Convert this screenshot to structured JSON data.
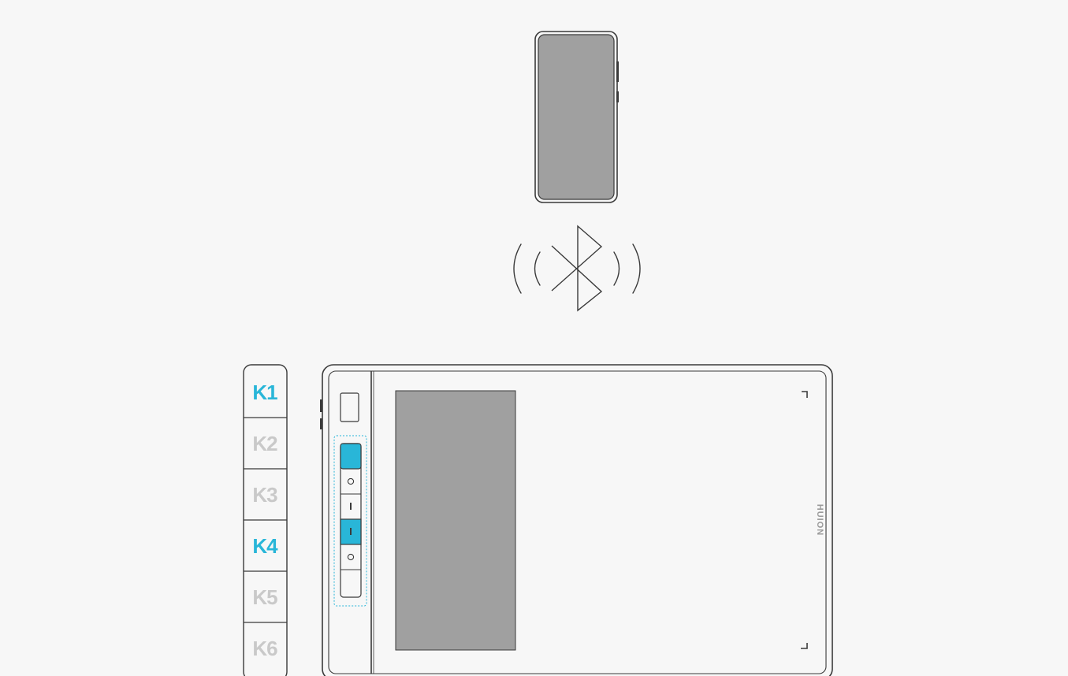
{
  "colors": {
    "background": "#f7f7f7",
    "outline": "#3a3a3a",
    "screen": "#a0a0a0",
    "accent": "#29b6d8",
    "inactive": "#c9c9c9"
  },
  "bluetooth": {
    "icon": "bluetooth-icon"
  },
  "keys": [
    {
      "label": "K1",
      "active": true
    },
    {
      "label": "K2",
      "active": false
    },
    {
      "label": "K3",
      "active": false
    },
    {
      "label": "K4",
      "active": true
    },
    {
      "label": "K5",
      "active": false
    },
    {
      "label": "K6",
      "active": false
    }
  ],
  "tablet": {
    "brand": "HUION"
  }
}
